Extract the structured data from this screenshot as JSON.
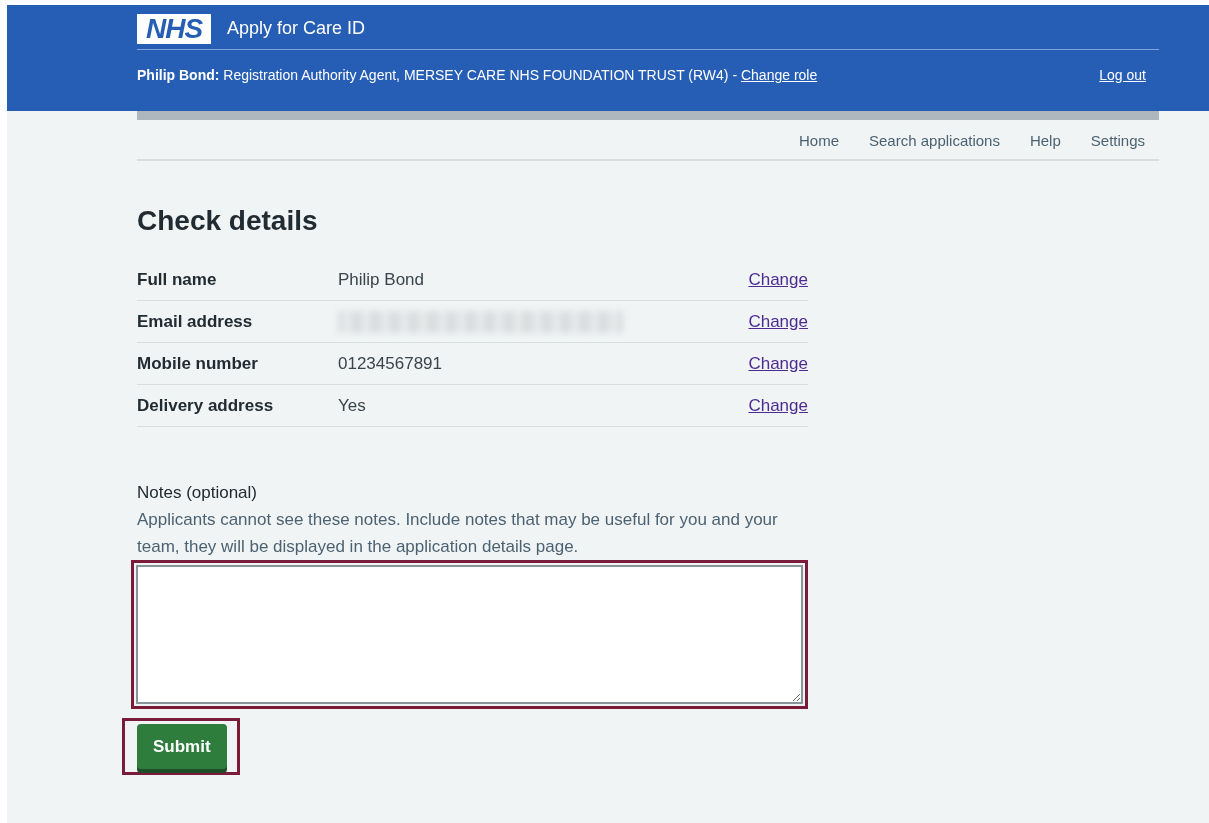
{
  "header": {
    "logo": "NHS",
    "service_name": "Apply for Care ID",
    "user_name": "Philip Bond:",
    "role_text": "Registration Authority Agent, MERSEY CARE NHS FOUNDATION TRUST (RW4) -",
    "change_role_link": "Change role",
    "logout_link": "Log out"
  },
  "nav": [
    {
      "label": "Home"
    },
    {
      "label": "Search applications"
    },
    {
      "label": "Help"
    },
    {
      "label": "Settings"
    }
  ],
  "page_title": "Check details",
  "summary_rows": [
    {
      "label": "Full name",
      "kind": "text",
      "value": "Philip Bond",
      "action": "Change"
    },
    {
      "label": "Email address",
      "kind": "redacted",
      "action": "Change"
    },
    {
      "label": "Mobile number",
      "kind": "text",
      "value": "01234567891",
      "action": "Change"
    },
    {
      "label": "Delivery address",
      "kind": "text",
      "value": "Yes",
      "action": "Change"
    }
  ],
  "notes": {
    "label": "Notes (optional)",
    "hint": "Applicants cannot see these notes. Include notes that may be useful for you and your team, they will be displayed in the application details page.",
    "highlighted": true
  },
  "submit": {
    "label": "Submit",
    "highlighted": true
  }
}
